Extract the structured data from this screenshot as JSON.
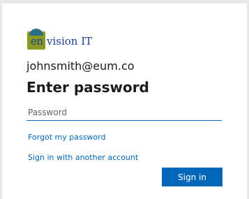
{
  "brand": {
    "logo_prefix": "en",
    "logo_suffix": "vision IT"
  },
  "account": {
    "email": "johnsmith@eum.co"
  },
  "heading": "Enter password",
  "password_field": {
    "placeholder": "Password",
    "value": ""
  },
  "links": {
    "forgot": "Forgot my password",
    "other_account": "Sign in with another account"
  },
  "sign_in_button": "Sign in",
  "colors": {
    "accent": "#0067b8",
    "text": "#1b1b1b"
  }
}
